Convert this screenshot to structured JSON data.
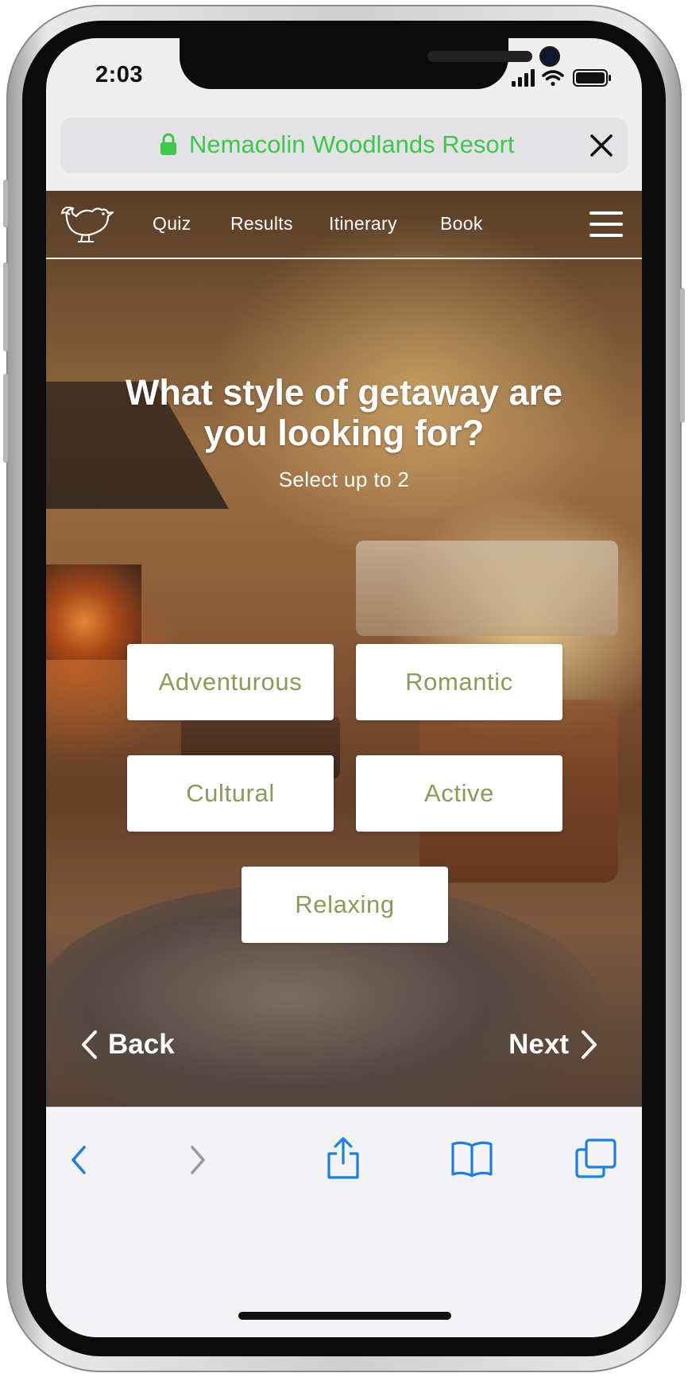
{
  "status_bar": {
    "time": "2:03"
  },
  "browser": {
    "url_title": "Nemacolin Woodlands Resort"
  },
  "site_nav": {
    "links": [
      "Quiz",
      "Results",
      "Itinerary",
      "Book"
    ]
  },
  "quiz": {
    "question": "What style of getaway are you looking for?",
    "instruction": "Select up to 2",
    "options": [
      "Adventurous",
      "Romantic",
      "Cultural",
      "Active",
      "Relaxing"
    ],
    "back_label": "Back",
    "next_label": "Next"
  },
  "colors": {
    "url_green": "#3cc84b",
    "option_text": "#8b9b58",
    "toolbar_blue": "#1a7fe6"
  },
  "icons": {
    "status": [
      "cellular-signal-icon",
      "wifi-icon",
      "battery-icon"
    ],
    "browser": [
      "lock-icon",
      "close-icon"
    ],
    "site": [
      "bird-logo-icon",
      "hamburger-menu-icon",
      "chevron-left-icon",
      "chevron-right-icon"
    ],
    "toolbar": [
      "back-arrow-icon",
      "forward-arrow-icon",
      "share-icon",
      "bookmarks-icon",
      "tabs-icon"
    ]
  }
}
